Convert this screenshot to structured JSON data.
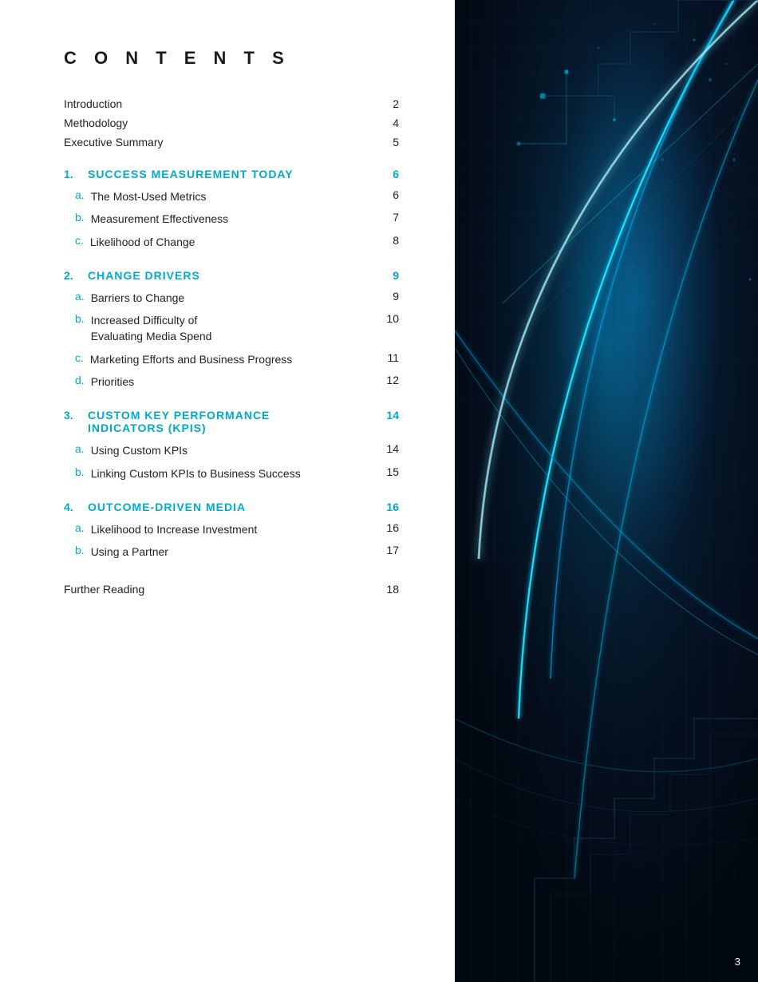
{
  "contents": {
    "heading": "C O N T E N T S",
    "plain_entries": [
      {
        "label": "Introduction",
        "page": "2"
      },
      {
        "label": "Methodology",
        "page": "4"
      },
      {
        "label": "Executive Summary",
        "page": "5"
      }
    ],
    "sections": [
      {
        "num": "1.",
        "title": "SUCCESS MEASUREMENT TODAY",
        "page": "6",
        "sub_entries": [
          {
            "letter": "a.",
            "label": "The Most-Used Metrics",
            "page": "6"
          },
          {
            "letter": "b.",
            "label": "Measurement Effectiveness",
            "page": "7"
          },
          {
            "letter": "c.",
            "label": "Likelihood of Change",
            "page": "8"
          }
        ]
      },
      {
        "num": "2.",
        "title": "CHANGE DRIVERS",
        "page": "9",
        "sub_entries": [
          {
            "letter": "a.",
            "label": "Barriers to Change",
            "page": "9"
          },
          {
            "letter": "b.",
            "label": "Increased Difficulty of\nEvaluating Media Spend",
            "page": "10"
          },
          {
            "letter": "c.",
            "label": "Marketing Efforts and Business Progress",
            "page": "11"
          },
          {
            "letter": "d.",
            "label": "Priorities",
            "page": "12"
          }
        ]
      },
      {
        "num": "3.",
        "title": "CUSTOM KEY PERFORMANCE\nINDICATORS (KPIS)",
        "page": "14",
        "sub_entries": [
          {
            "letter": "a.",
            "label": "Using Custom KPIs",
            "page": "14"
          },
          {
            "letter": "b.",
            "label": "Linking Custom KPIs to Business Success",
            "page": "15"
          }
        ]
      },
      {
        "num": "4.",
        "title": "OUTCOME-DRIVEN MEDIA",
        "page": "16",
        "sub_entries": [
          {
            "letter": "a.",
            "label": "Likelihood to Increase Investment",
            "page": "16"
          },
          {
            "letter": "b.",
            "label": "Using a Partner",
            "page": "17"
          }
        ]
      }
    ],
    "further_reading": {
      "label": "Further Reading",
      "page": "18"
    }
  },
  "page_number": "3"
}
